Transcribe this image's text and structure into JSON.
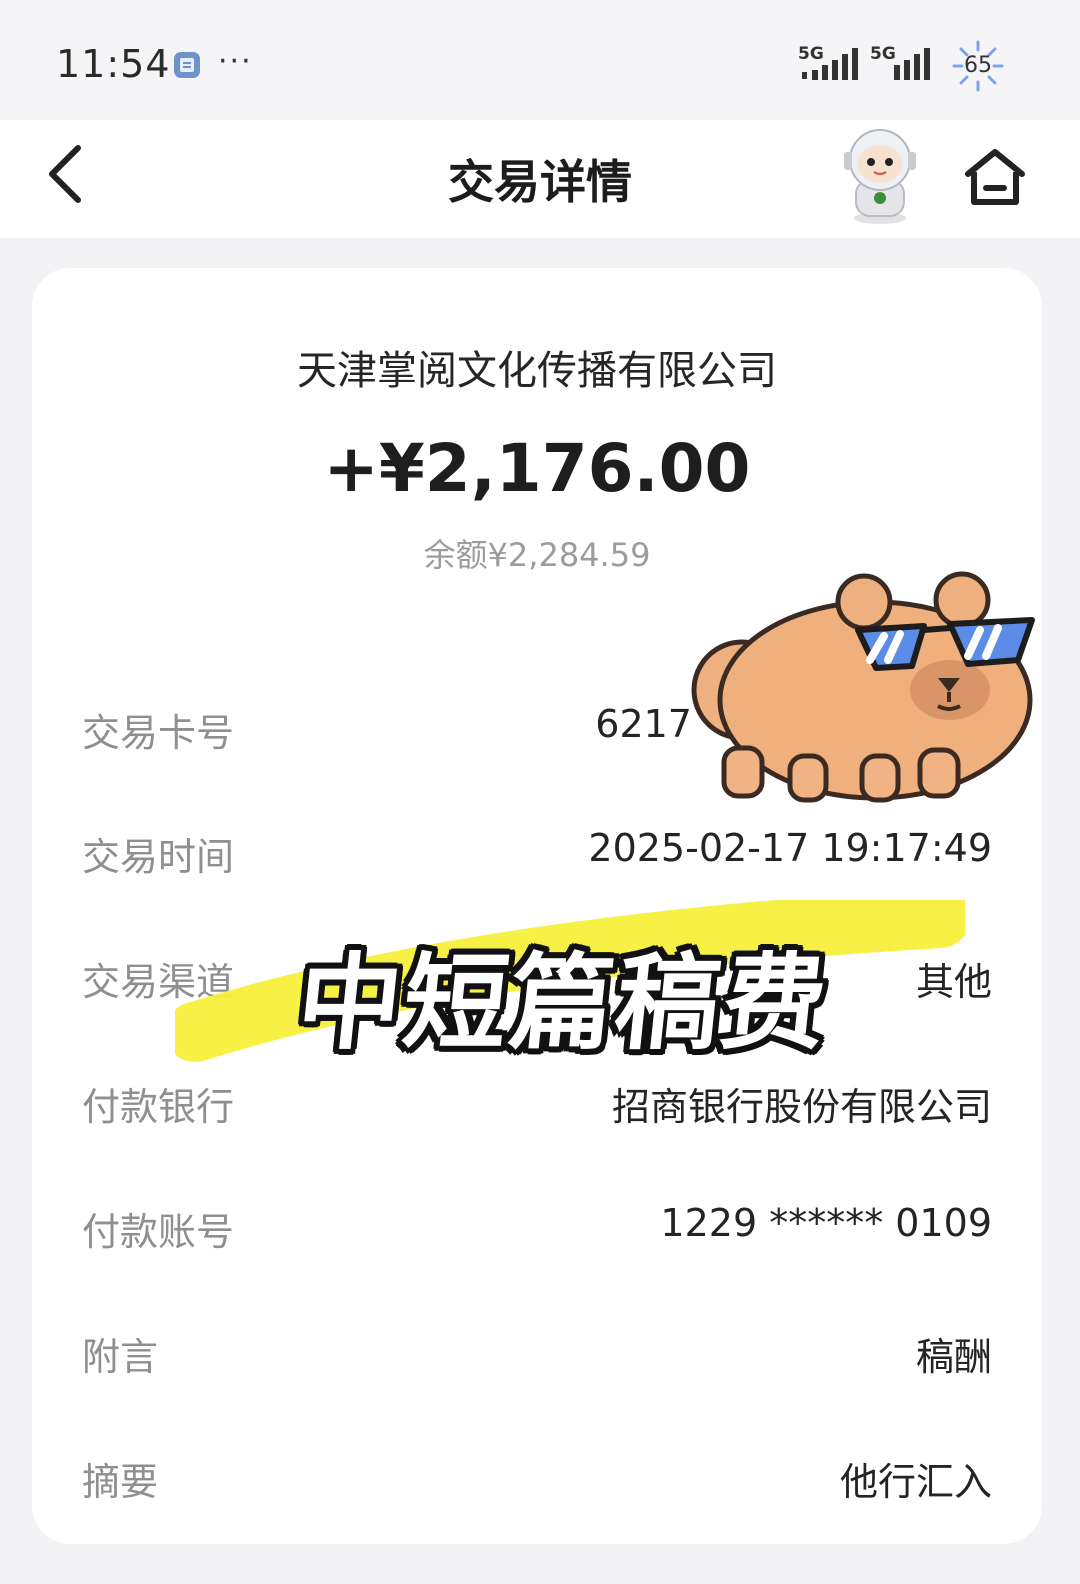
{
  "status_bar": {
    "time": "11:54",
    "more": "···",
    "network_1": "5G",
    "network_2": "5G",
    "battery_level": "65"
  },
  "header": {
    "title": "交易详情",
    "icons": [
      "back-arrow-icon",
      "robot-assistant-icon",
      "home-icon"
    ]
  },
  "transaction": {
    "counterparty": "天津掌阅文化传播有限公司",
    "amount": "+¥2,176.00",
    "balance": "余额¥2,284.59"
  },
  "details": [
    {
      "label": "交易卡号",
      "value": "6217"
    },
    {
      "label": "交易时间",
      "value": "2025-02-17 19:17:49"
    },
    {
      "label": "交易渠道",
      "value": "其他"
    },
    {
      "label": "付款银行",
      "value": "招商银行股份有限公司"
    },
    {
      "label": "付款账号",
      "value": "1229 ****** 0109"
    },
    {
      "label": "附言",
      "value": "稿酬"
    },
    {
      "label": "摘要",
      "value": "他行汇入"
    }
  ],
  "overlay": {
    "caption": "中短篇稿费",
    "highlight_color": "#f6f03a",
    "sticker": "capybara-sunglasses-sticker"
  },
  "colors": {
    "background": "#f3f3f5",
    "card": "#ffffff",
    "label_gray": "#8f8f8f",
    "text_dark": "#242424"
  }
}
